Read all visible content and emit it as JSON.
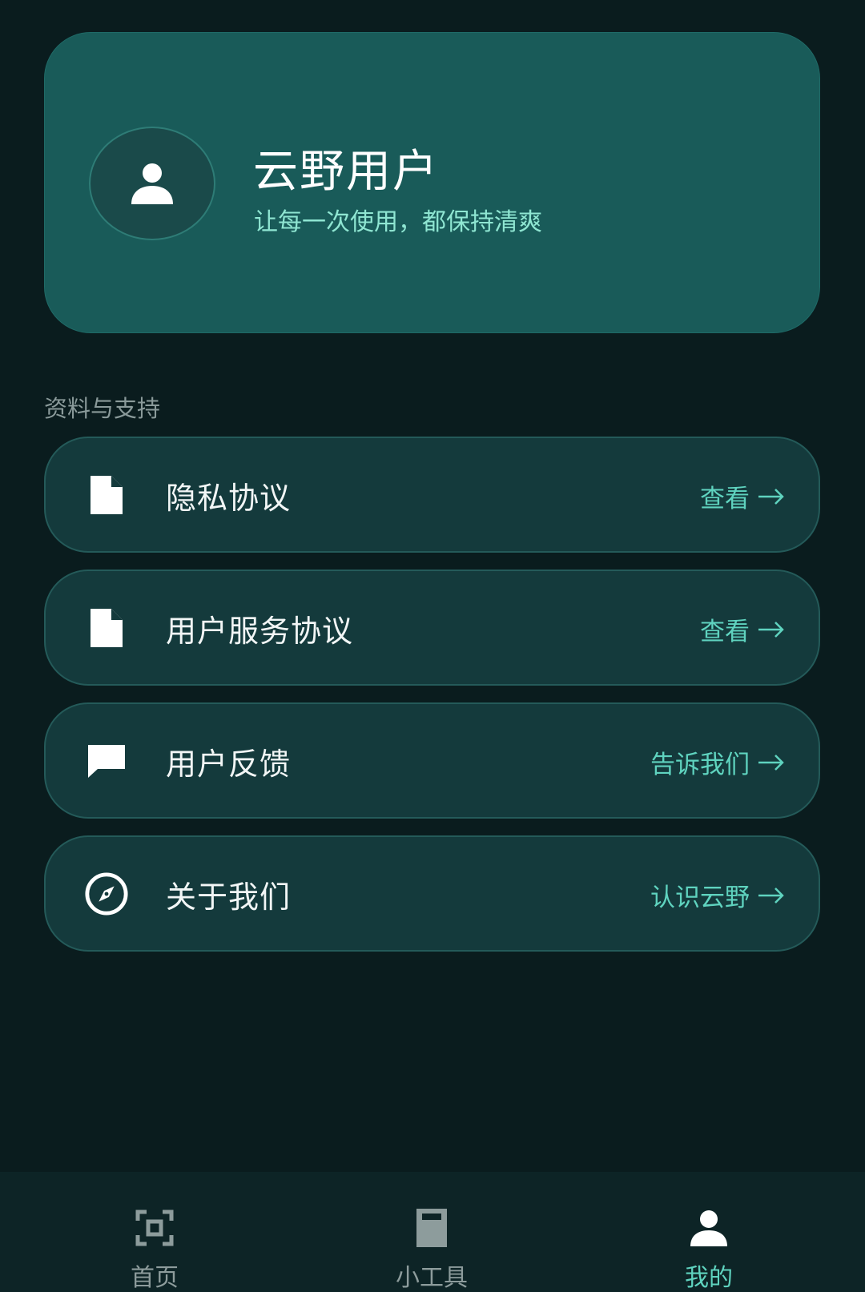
{
  "profile": {
    "name": "云野用户",
    "slogan": "让每一次使用，都保持清爽",
    "avatar_icon": "user-icon"
  },
  "section": {
    "title": "资料与支持"
  },
  "items": [
    {
      "label": "隐私协议",
      "action": "查看",
      "icon": "document-icon"
    },
    {
      "label": "用户服务协议",
      "action": "查看",
      "icon": "document-icon"
    },
    {
      "label": "用户反馈",
      "action": "告诉我们",
      "icon": "chat-icon"
    },
    {
      "label": "关于我们",
      "action": "认识云野",
      "icon": "compass-icon"
    }
  ],
  "nav": {
    "items": [
      {
        "label": "首页",
        "icon": "scan-icon",
        "active": false
      },
      {
        "label": "小工具",
        "icon": "tool-icon",
        "active": false
      },
      {
        "label": "我的",
        "icon": "user-icon",
        "active": true
      }
    ]
  },
  "colors": {
    "background": "#0a1c1e",
    "card": "#195b59",
    "list_item": "#143a3c",
    "accent": "#5fd3bf",
    "muted": "#8d9c9c"
  }
}
